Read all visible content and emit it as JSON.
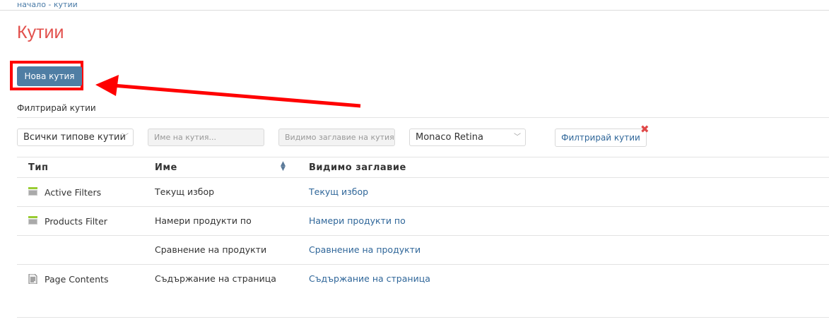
{
  "breadcrumb": "начало - кутии",
  "title": "Кутии",
  "new_button": "Нова кутия",
  "filter_label": "Филтрирай кутии",
  "filters": {
    "type_select": "Всички типове кутии",
    "name_placeholder": "Име на кутия...",
    "visible_title_placeholder": "Видимо заглавие на кутия",
    "theme_select": "Monaco Retina",
    "filter_button": "Филтрирай кутии"
  },
  "table": {
    "headers": [
      "Тип",
      "Име",
      "Видимо заглавие"
    ],
    "rows": [
      {
        "type": "Active Filters",
        "icon": "list-icon",
        "name": "Текущ избор",
        "title": "Текущ избор"
      },
      {
        "type": "Products Filter",
        "icon": "list-icon",
        "name": "Намери продукти по",
        "title": "Намери продукти по"
      },
      {
        "type": "",
        "icon": "",
        "name": "Сравнение на продукти",
        "title": "Сравнение на продукти"
      },
      {
        "type": "Page Contents",
        "icon": "document-icon",
        "name": "Съдържание на страница",
        "title": "Съдържание на страница"
      }
    ]
  },
  "colors": {
    "accent": "#4f7ea4",
    "title": "#e2504c",
    "link": "#2f6699",
    "annotation": "#ff0000"
  }
}
